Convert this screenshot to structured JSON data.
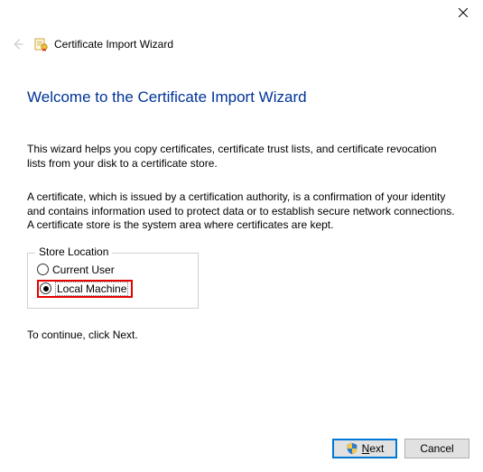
{
  "titlebar": {
    "close_tooltip": "Close"
  },
  "header": {
    "title": "Certificate Import Wizard"
  },
  "main": {
    "welcome_title": "Welcome to the Certificate Import Wizard",
    "para1": "This wizard helps you copy certificates, certificate trust lists, and certificate revocation lists from your disk to a certificate store.",
    "para2": "A certificate, which is issued by a certification authority, is a confirmation of your identity and contains information used to protect data or to establish secure network connections. A certificate store is the system area where certificates are kept.",
    "storeLocation": {
      "legend": "Store Location",
      "currentUser": "Current User",
      "localMachine": "Local Machine",
      "selected": "localMachine"
    },
    "continue_text": "To continue, click Next."
  },
  "footer": {
    "next_access": "N",
    "next_rest": "ext",
    "cancel": "Cancel"
  }
}
